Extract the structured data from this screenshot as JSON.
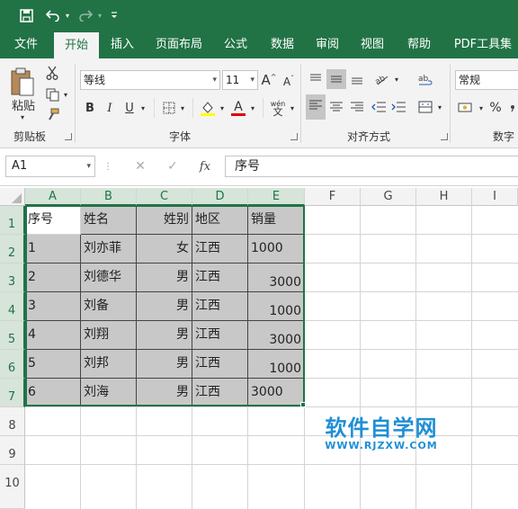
{
  "qat": {
    "save_icon": "save-icon",
    "undo_icon": "undo-icon",
    "redo_icon": "redo-icon",
    "customize_icon": "customize-dropdown-icon"
  },
  "tabs": [
    {
      "label": "文件"
    },
    {
      "label": "开始"
    },
    {
      "label": "插入"
    },
    {
      "label": "页面布局"
    },
    {
      "label": "公式"
    },
    {
      "label": "数据"
    },
    {
      "label": "审阅"
    },
    {
      "label": "视图"
    },
    {
      "label": "帮助"
    },
    {
      "label": "PDF工具集"
    }
  ],
  "ribbon": {
    "clipboard": {
      "paste_label": "粘贴",
      "group_label": "剪贴板"
    },
    "font": {
      "name": "等线",
      "size": "11",
      "bold": "B",
      "italic": "I",
      "underline": "U",
      "grow": "A",
      "shrink": "A",
      "font_color_glyph": "A",
      "phonetic": "wén",
      "group_label": "字体"
    },
    "alignment": {
      "group_label": "对齐方式"
    },
    "number": {
      "format": "常规",
      "percent": "%",
      "group_label": "数字"
    }
  },
  "formula_bar": {
    "name_box": "A1",
    "cancel": "✕",
    "enter": "✓",
    "fx": "fx",
    "content": "序号"
  },
  "columns": [
    "A",
    "B",
    "C",
    "D",
    "E",
    "F",
    "G",
    "H",
    "I"
  ],
  "rows": [
    "1",
    "2",
    "3",
    "4",
    "5",
    "6",
    "7",
    "8",
    "9",
    "10"
  ],
  "table": [
    [
      "序号",
      "姓名",
      "姓别",
      "地区",
      "销量"
    ],
    [
      "1",
      "刘亦菲",
      "女",
      "江西",
      "1000"
    ],
    [
      "2",
      "刘德华",
      "男",
      "江西",
      "3000"
    ],
    [
      "3",
      "刘备",
      "男",
      "江西",
      "1000"
    ],
    [
      "4",
      "刘翔",
      "男",
      "江西",
      "3000"
    ],
    [
      "5",
      "刘邦",
      "男",
      "江西",
      "1000"
    ],
    [
      "6",
      "刘海",
      "男",
      "江西",
      "3000"
    ]
  ],
  "watermark": {
    "title": "软件自学网",
    "url": "WWW.RJZXW.COM"
  },
  "colors": {
    "accent": "#217346",
    "selection_fill": "#c8c8c8",
    "watermark": "#1e8fd6"
  }
}
